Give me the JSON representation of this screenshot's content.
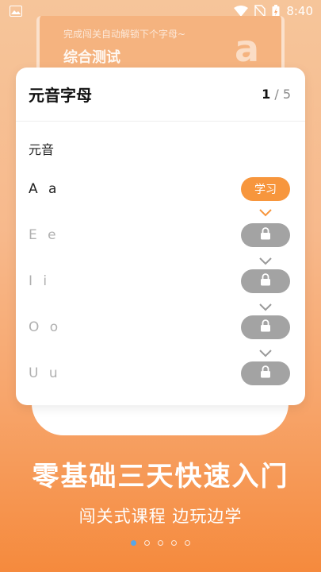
{
  "status_bar": {
    "time": "8:40",
    "icons": [
      "image-icon",
      "wifi-icon",
      "no-sim-icon",
      "battery-charging-icon"
    ]
  },
  "background_card": {
    "subtitle": "完成闯关自动解锁下个字母~",
    "title": "综合测试",
    "letter": "a"
  },
  "card": {
    "title": "元音字母",
    "page_current": "1",
    "page_separator": "/",
    "page_total": "5",
    "section": "元音",
    "rows": [
      {
        "letters": "A a",
        "state": "unlocked",
        "button_label": "学习"
      },
      {
        "letters": "E e",
        "state": "locked"
      },
      {
        "letters": "I i",
        "state": "locked"
      },
      {
        "letters": "O o",
        "state": "locked"
      },
      {
        "letters": "U u",
        "state": "locked"
      }
    ]
  },
  "headline": "零基础三天快速入门",
  "subline": "闯关式课程 边玩边学",
  "pagination": {
    "count": 5,
    "active_index": 0
  },
  "colors": {
    "accent": "#f7963d",
    "locked": "#a3a3a3",
    "active_dot": "#59a6e6"
  }
}
